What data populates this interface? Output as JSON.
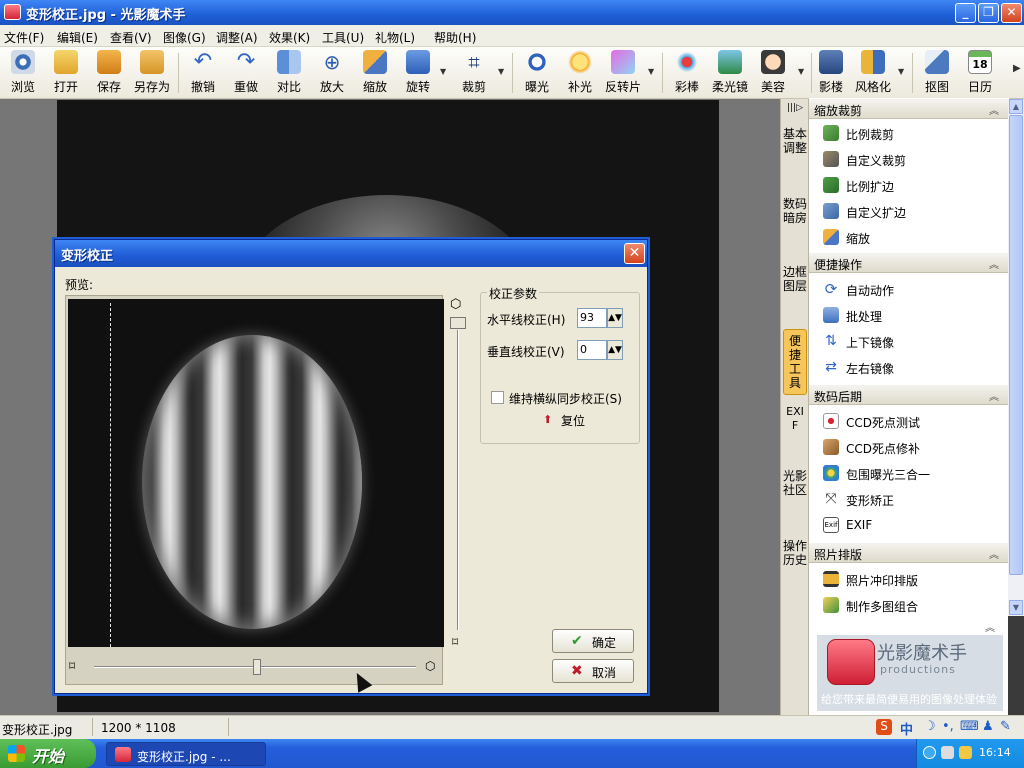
{
  "window": {
    "title": "变形校正.jpg - 光影魔术手"
  },
  "menus": [
    "文件(F)",
    "编辑(E)",
    "查看(V)",
    "图像(G)",
    "调整(A)",
    "效果(K)",
    "工具(U)",
    "礼物(L)",
    "帮助(H)"
  ],
  "toolbar": [
    "浏览",
    "打开",
    "保存",
    "另存为",
    "撤销",
    "重做",
    "对比",
    "放大",
    "缩放",
    "旋转",
    "裁剪",
    "曝光",
    "补光",
    "反转片",
    "彩棒",
    "柔光镜",
    "美容",
    "影楼",
    "风格化",
    "抠图",
    "日历"
  ],
  "calendar_day": "18",
  "side_tabs": [
    "基本调整",
    "数码暗房",
    "边框图层",
    "便捷工具",
    "EXIF",
    "光影社区",
    "操作历史"
  ],
  "panel": {
    "sections": [
      {
        "title": "缩放裁剪",
        "items": [
          "比例裁剪",
          "自定义裁剪",
          "比例扩边",
          "自定义扩边",
          "缩放"
        ]
      },
      {
        "title": "便捷操作",
        "items": [
          "自动动作",
          "批处理",
          "上下镜像",
          "左右镜像"
        ]
      },
      {
        "title": "数码后期",
        "items": [
          "CCD死点测试",
          "CCD死点修补",
          "包围曝光三合一",
          "变形矫正",
          "EXIF"
        ]
      },
      {
        "title": "照片排版",
        "items": [
          "照片冲印排版",
          "制作多图组合"
        ]
      }
    ],
    "brand": {
      "name": "光影魔术手",
      "sub": "productions",
      "slogan": "给您带来最简便易用的图像处理体验"
    }
  },
  "dialog": {
    "title": "变形校正",
    "preview_label": "预览:",
    "group_title": "校正参数",
    "horizontal_label": "水平线校正(H)",
    "horizontal_value": "93",
    "vertical_label": "垂直线校正(V)",
    "vertical_value": "0",
    "sync_label": "维持横纵同步校正(S)",
    "sync_checked": false,
    "reset_label": "复位",
    "ok_label": "确定",
    "cancel_label": "取消"
  },
  "status": {
    "filename": "变形校正.jpg",
    "dimensions": "1200 * 1108"
  },
  "taskbar": {
    "start": "开始",
    "task": "变形校正.jpg - ...",
    "clock": "16:14"
  },
  "ime": {
    "mode": "中"
  }
}
